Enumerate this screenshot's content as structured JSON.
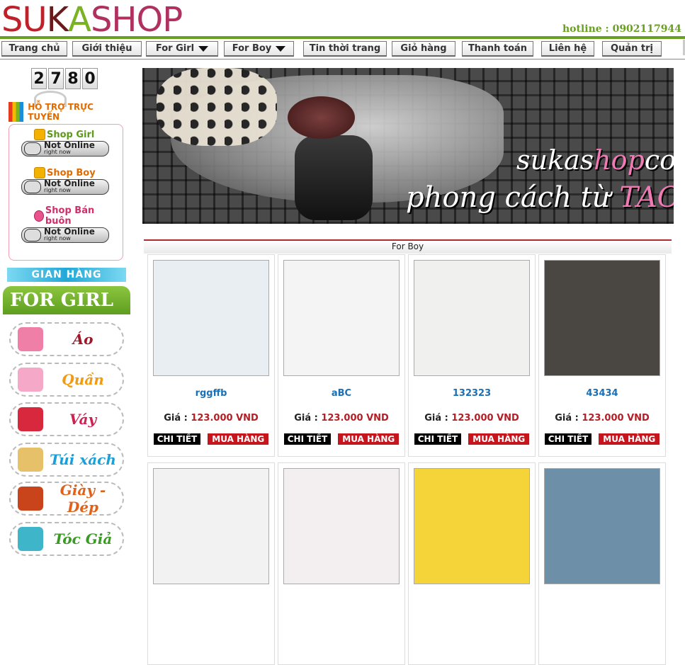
{
  "logo": {
    "letters": [
      "S",
      "U",
      "K",
      "A",
      "S",
      "H",
      "O",
      "P"
    ],
    "colors": [
      "#c0202a",
      "#c0202a",
      "#6a1a1a",
      "#7ab321",
      "#b03060",
      "#b03060",
      "#b03060",
      "#b03060"
    ]
  },
  "hotline": "hotline : 0902117944",
  "nav": [
    {
      "label": "Trang chủ",
      "dropdown": false
    },
    {
      "label": "Giới thiệu",
      "dropdown": false
    },
    {
      "label": "For Girl",
      "dropdown": true
    },
    {
      "label": "For Boy",
      "dropdown": true
    },
    {
      "label": "Tin thời trang",
      "dropdown": false
    },
    {
      "label": "Giỏ hàng",
      "dropdown": false
    },
    {
      "label": "Thanh toán",
      "dropdown": false
    },
    {
      "label": "Liên hệ",
      "dropdown": false
    },
    {
      "label": "Quản trị",
      "dropdown": false
    }
  ],
  "counter": [
    "2",
    "7",
    "8",
    "0"
  ],
  "support": {
    "title": "HỖ TRỢ TRỰC TUYẾN",
    "shops": [
      {
        "label": "Shop Girl",
        "color": "#5c9a1a",
        "status": "Not Online",
        "sub": "right now",
        "icon": "shop-icon"
      },
      {
        "label": "Shop Boy",
        "color": "#e06b00",
        "status": "Not Online",
        "sub": "right now",
        "icon": "shop-icon"
      },
      {
        "label": "Shop Bán buôn",
        "color": "#d0306a",
        "status": "Not Online",
        "sub": "right now",
        "icon": "doll-icon"
      }
    ]
  },
  "store_heading": "GIAN HÀNG",
  "category_heading": "FOR GIRL",
  "categories": [
    {
      "label": "Áo",
      "color": "#a0162a",
      "icon": "shirt-icon",
      "icon_color": "#ef7fa7"
    },
    {
      "label": "Quần",
      "color": "#f29a12",
      "icon": "pants-icon",
      "icon_color": "#f6a8c8"
    },
    {
      "label": "Váy",
      "color": "#d01f52",
      "icon": "dress-icon",
      "icon_color": "#d8283e"
    },
    {
      "label": "Túi xách",
      "color": "#1aa0d8",
      "icon": "bag-icon",
      "icon_color": "#e7c06a"
    },
    {
      "label": "Giày - Dép",
      "color": "#e0621a",
      "icon": "star-icon",
      "icon_color": "#c9441a"
    },
    {
      "label": "Tóc Giả",
      "color": "#3a9a24",
      "icon": "wig-icon",
      "icon_color": "#3fb5c9"
    }
  ],
  "banner": {
    "site_a": "sukas",
    "site_b": "hop",
    "site_c": "com",
    "slogan_a": "phong cách từ ",
    "slogan_b": "TAOBAO"
  },
  "section_title": "For Boy",
  "price_label": "Giá : ",
  "detail_label": "CHI TIẾT",
  "buy_label": "MUA HÀNG",
  "products": [
    {
      "name": "rggffb",
      "price": "123.000 VND",
      "thumb": "#e9eef2"
    },
    {
      "name": "aBC",
      "price": "123.000 VND",
      "thumb": "#f4f4f4"
    },
    {
      "name": "132323",
      "price": "123.000 VND",
      "thumb": "#f0f0ee"
    },
    {
      "name": "43434",
      "price": "123.000 VND",
      "thumb": "#4a4742"
    }
  ],
  "products_row2": [
    {
      "thumb": "#f2f2f2"
    },
    {
      "thumb": "#f3eef0"
    },
    {
      "thumb": "#f5d43a"
    },
    {
      "thumb": "#6d8fa8"
    }
  ]
}
